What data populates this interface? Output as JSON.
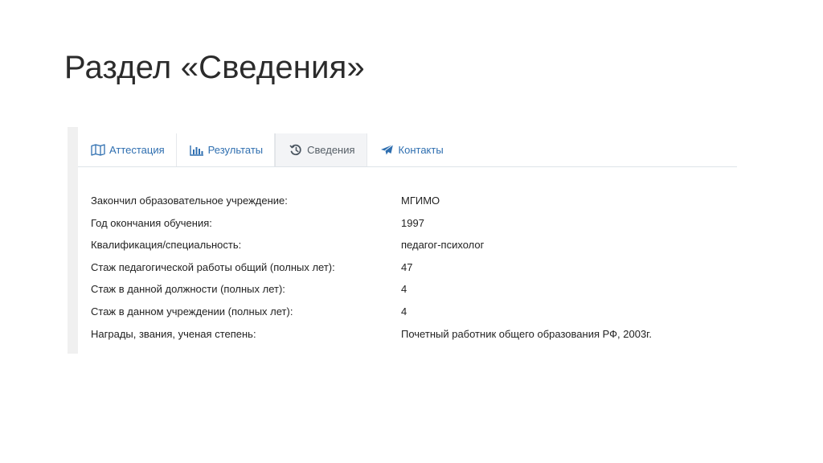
{
  "slide": {
    "title": "Раздел «Сведения»"
  },
  "tabs": [
    {
      "id": "attestation",
      "label": "Аттестация",
      "icon": "map-icon",
      "active": false
    },
    {
      "id": "results",
      "label": "Результаты",
      "icon": "bar-chart-icon",
      "active": false
    },
    {
      "id": "info",
      "label": "Сведения",
      "icon": "history-icon",
      "active": true
    },
    {
      "id": "contacts",
      "label": "Контакты",
      "icon": "paper-plane-icon",
      "active": false
    }
  ],
  "info": {
    "rows": [
      {
        "label": "Закончил образовательное учреждение:",
        "value": "МГИМО"
      },
      {
        "label": "Год окончания обучения:",
        "value": "1997"
      },
      {
        "label": "Квалификация/специальность:",
        "value": "педагог-психолог"
      },
      {
        "label": "Стаж педагогической работы общий (полных лет):",
        "value": "47"
      },
      {
        "label": "Стаж в данной должности (полных лет):",
        "value": "4"
      },
      {
        "label": "Стаж в данном учреждении (полных лет):",
        "value": "4"
      },
      {
        "label": "Награды, звания, ученая степень:",
        "value": "Почетный работник общего образования РФ, 2003г."
      }
    ]
  },
  "colors": {
    "link": "#2f6fb0",
    "active_tab_bg": "#f3f4f6",
    "text": "#222222"
  }
}
